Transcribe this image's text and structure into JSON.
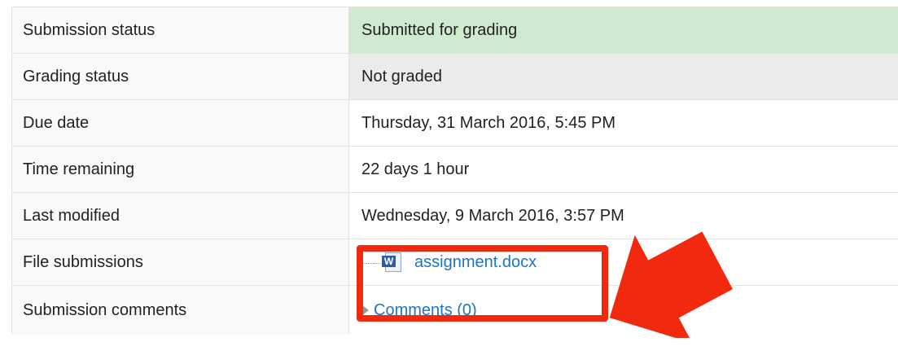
{
  "rows": [
    {
      "label": "Submission status",
      "value": "Submitted for grading"
    },
    {
      "label": "Grading status",
      "value": "Not graded"
    },
    {
      "label": "Due date",
      "value": "Thursday, 31 March 2016, 5:45 PM"
    },
    {
      "label": "Time remaining",
      "value": "22 days 1 hour"
    },
    {
      "label": "Last modified",
      "value": "Wednesday, 9 March 2016, 3:57 PM"
    },
    {
      "label": "File submissions",
      "file": {
        "icon": "word-doc-icon",
        "icon_text": "W",
        "name": "assignment.docx"
      }
    },
    {
      "label": "Submission comments",
      "comments_link": "Comments (0)"
    }
  ],
  "colors": {
    "submitted_bg": "#cfeacf",
    "not_graded_bg": "#ebebeb",
    "link": "#1e74c8",
    "annotation_red": "#f0290f"
  }
}
